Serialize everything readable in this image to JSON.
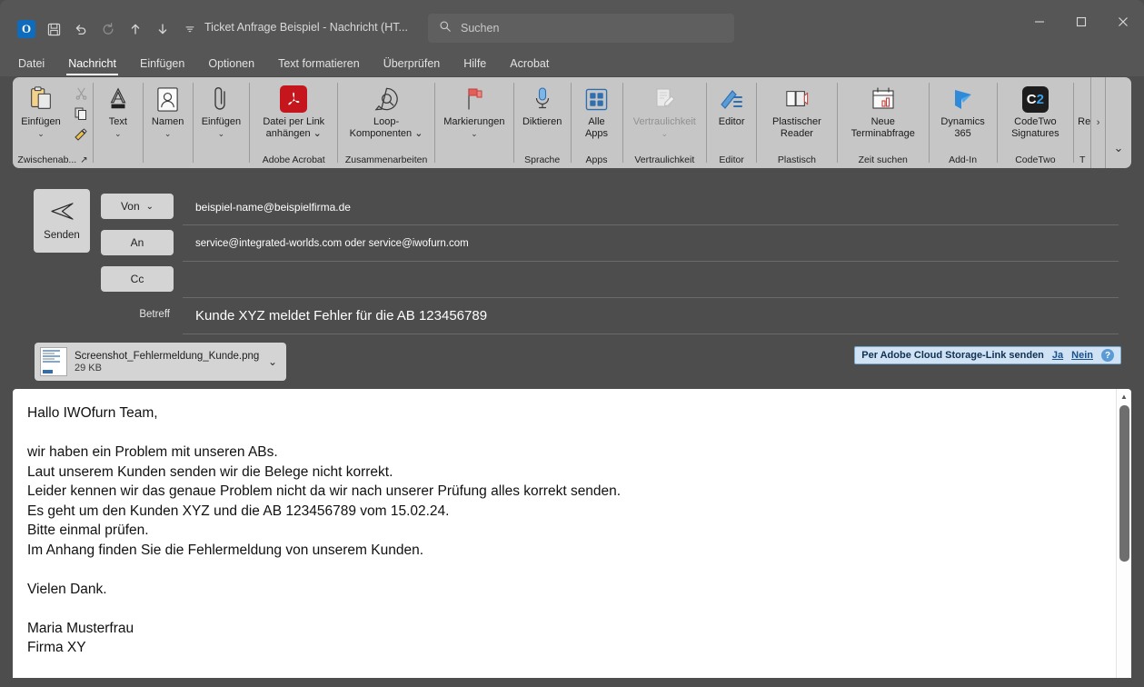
{
  "window": {
    "title": "Ticket Anfrage Beispiel  -  Nachricht (HT...",
    "controls": {
      "minimize": "─",
      "maximize": "☐",
      "close": "✕"
    }
  },
  "quick_access": {
    "app_icon": "outlook-icon",
    "app_letter": "O",
    "items": [
      {
        "name": "save-icon",
        "glyph": "💾"
      },
      {
        "name": "undo-icon",
        "glyph": "↶"
      },
      {
        "name": "redo-icon",
        "glyph": "↻"
      },
      {
        "name": "move-up-icon",
        "glyph": "↑"
      },
      {
        "name": "move-down-icon",
        "glyph": "↓"
      },
      {
        "name": "customize-qat-icon",
        "glyph": "⌄"
      }
    ]
  },
  "search": {
    "placeholder": "Suchen",
    "icon": "search-icon"
  },
  "tabs": [
    {
      "label": "Datei",
      "active": false
    },
    {
      "label": "Nachricht",
      "active": true
    },
    {
      "label": "Einfügen",
      "active": false
    },
    {
      "label": "Optionen",
      "active": false
    },
    {
      "label": "Text formatieren",
      "active": false
    },
    {
      "label": "Überprüfen",
      "active": false
    },
    {
      "label": "Hilfe",
      "active": false
    },
    {
      "label": "Acrobat",
      "active": false
    }
  ],
  "ribbon": {
    "overflow_chevron": "›",
    "collapse_chevron": "⌄",
    "groups": [
      {
        "label": "Zwischenab...",
        "has_launcher": true,
        "launcher_glyph": "⤡",
        "items": [
          {
            "label": "Einfügen",
            "icon": "clipboard-paste-icon",
            "has_chevron": true,
            "disabled": false
          },
          {
            "label": "",
            "icon": "cut-scissors-icon",
            "has_chevron": false,
            "disabled": true
          },
          {
            "label": "",
            "icon": "copy-icon",
            "has_chevron": false,
            "disabled": false
          },
          {
            "label": "",
            "icon": "format-painter-icon",
            "has_chevron": false,
            "disabled": false
          }
        ]
      },
      {
        "label": "",
        "items": [
          {
            "label": "Text",
            "icon": "text-format-icon",
            "has_chevron": true,
            "disabled": false
          }
        ]
      },
      {
        "label": "",
        "items": [
          {
            "label": "Namen",
            "icon": "address-book-icon",
            "has_chevron": true,
            "disabled": false
          }
        ]
      },
      {
        "label": "",
        "items": [
          {
            "label": "Einfügen",
            "icon": "paperclip-attach-icon",
            "has_chevron": true,
            "disabled": false
          }
        ]
      },
      {
        "label": "Adobe Acrobat",
        "items": [
          {
            "label": "Datei per Link anhängen ⌄",
            "icon": "adobe-pdf-icon",
            "has_chevron": false,
            "disabled": false
          }
        ]
      },
      {
        "label": "Zusammenarbeiten",
        "items": [
          {
            "label": "Loop-Komponenten ⌄",
            "icon": "loop-component-icon",
            "has_chevron": false,
            "disabled": false
          }
        ]
      },
      {
        "label": "",
        "items": [
          {
            "label": "Markierungen",
            "icon": "flag-tags-icon",
            "has_chevron": true,
            "disabled": false
          }
        ]
      },
      {
        "label": "Sprache",
        "items": [
          {
            "label": "Diktieren",
            "icon": "microphone-icon",
            "has_chevron": false,
            "disabled": false
          }
        ]
      },
      {
        "label": "Apps",
        "items": [
          {
            "label": "Alle Apps",
            "icon": "all-apps-grid-icon",
            "has_chevron": false,
            "disabled": false
          }
        ]
      },
      {
        "label": "Vertraulichkeit",
        "items": [
          {
            "label": "Vertraulichkeit",
            "icon": "sensitivity-label-icon",
            "has_chevron": true,
            "disabled": true
          }
        ]
      },
      {
        "label": "Editor",
        "items": [
          {
            "label": "Editor",
            "icon": "editor-pen-icon",
            "has_chevron": false,
            "disabled": false
          }
        ]
      },
      {
        "label": "Plastisch",
        "items": [
          {
            "label": "Plastischer Reader",
            "icon": "immersive-reader-icon",
            "has_chevron": false,
            "disabled": false
          }
        ]
      },
      {
        "label": "Zeit suchen",
        "items": [
          {
            "label": "Neue Terminabfrage",
            "icon": "calendar-poll-icon",
            "has_chevron": false,
            "disabled": false
          }
        ]
      },
      {
        "label": "Add-In",
        "items": [
          {
            "label": "Dynamics 365",
            "icon": "dynamics365-icon",
            "has_chevron": false,
            "disabled": false
          }
        ]
      },
      {
        "label": "CodeTwo",
        "items": [
          {
            "label": "CodeTwo Signatures",
            "icon": "codetwo-icon",
            "has_chevron": false,
            "disabled": false
          }
        ]
      },
      {
        "label": "T",
        "items": [
          {
            "label": "Re",
            "icon": "truncated-addin-icon",
            "has_chevron": false,
            "disabled": false
          }
        ]
      }
    ]
  },
  "compose": {
    "send_button": {
      "label": "Senden",
      "icon": "send-arrow-icon"
    },
    "from": {
      "button_label": "Von",
      "chevron": "⌄",
      "value": "beispiel-name@beispielfirma.de"
    },
    "to": {
      "button_label": "An",
      "value": "service@integrated-worlds.com oder service@iwofurn.com"
    },
    "cc": {
      "button_label": "Cc",
      "value": ""
    },
    "subject": {
      "label": "Betreff",
      "value": "Kunde XYZ meldet Fehler für die AB 123456789"
    }
  },
  "attachment": {
    "name": "Screenshot_Fehlermeldung_Kunde.png",
    "size": "29 KB",
    "chevron": "⌄",
    "thumbnail_icon": "image-thumbnail-icon"
  },
  "adobe_notice": {
    "text": "Per Adobe Cloud Storage-Link senden",
    "yes": "Ja",
    "no": "Nein",
    "help_glyph": "?"
  },
  "body": {
    "text": "Hallo IWOfurn Team,\n\nwir haben ein Problem mit unseren ABs.\nLaut unserem Kunden senden wir die Belege nicht korrekt.\nLeider kennen wir das genaue Problem nicht da wir nach unserer Prüfung alles korrekt senden.\nEs geht um den Kunden XYZ und die AB 123456789 vom 15.02.24.\nBitte einmal prüfen.\nIm Anhang finden Sie die Fehlermeldung von unserem Kunden.\n\nVielen Dank.\n\nMaria Musterfrau\nFirma XY"
  },
  "scrollbar": {
    "up_glyph": "▲"
  },
  "colors": {
    "titlebar": "#565656",
    "ribbon": "#c6c6c6",
    "window": "#4d4d4d",
    "body": "#ffffff",
    "accent_blue": "#0f6cbd",
    "adobe_red": "#c4161c",
    "notice_bg": "#cfe3f5"
  }
}
